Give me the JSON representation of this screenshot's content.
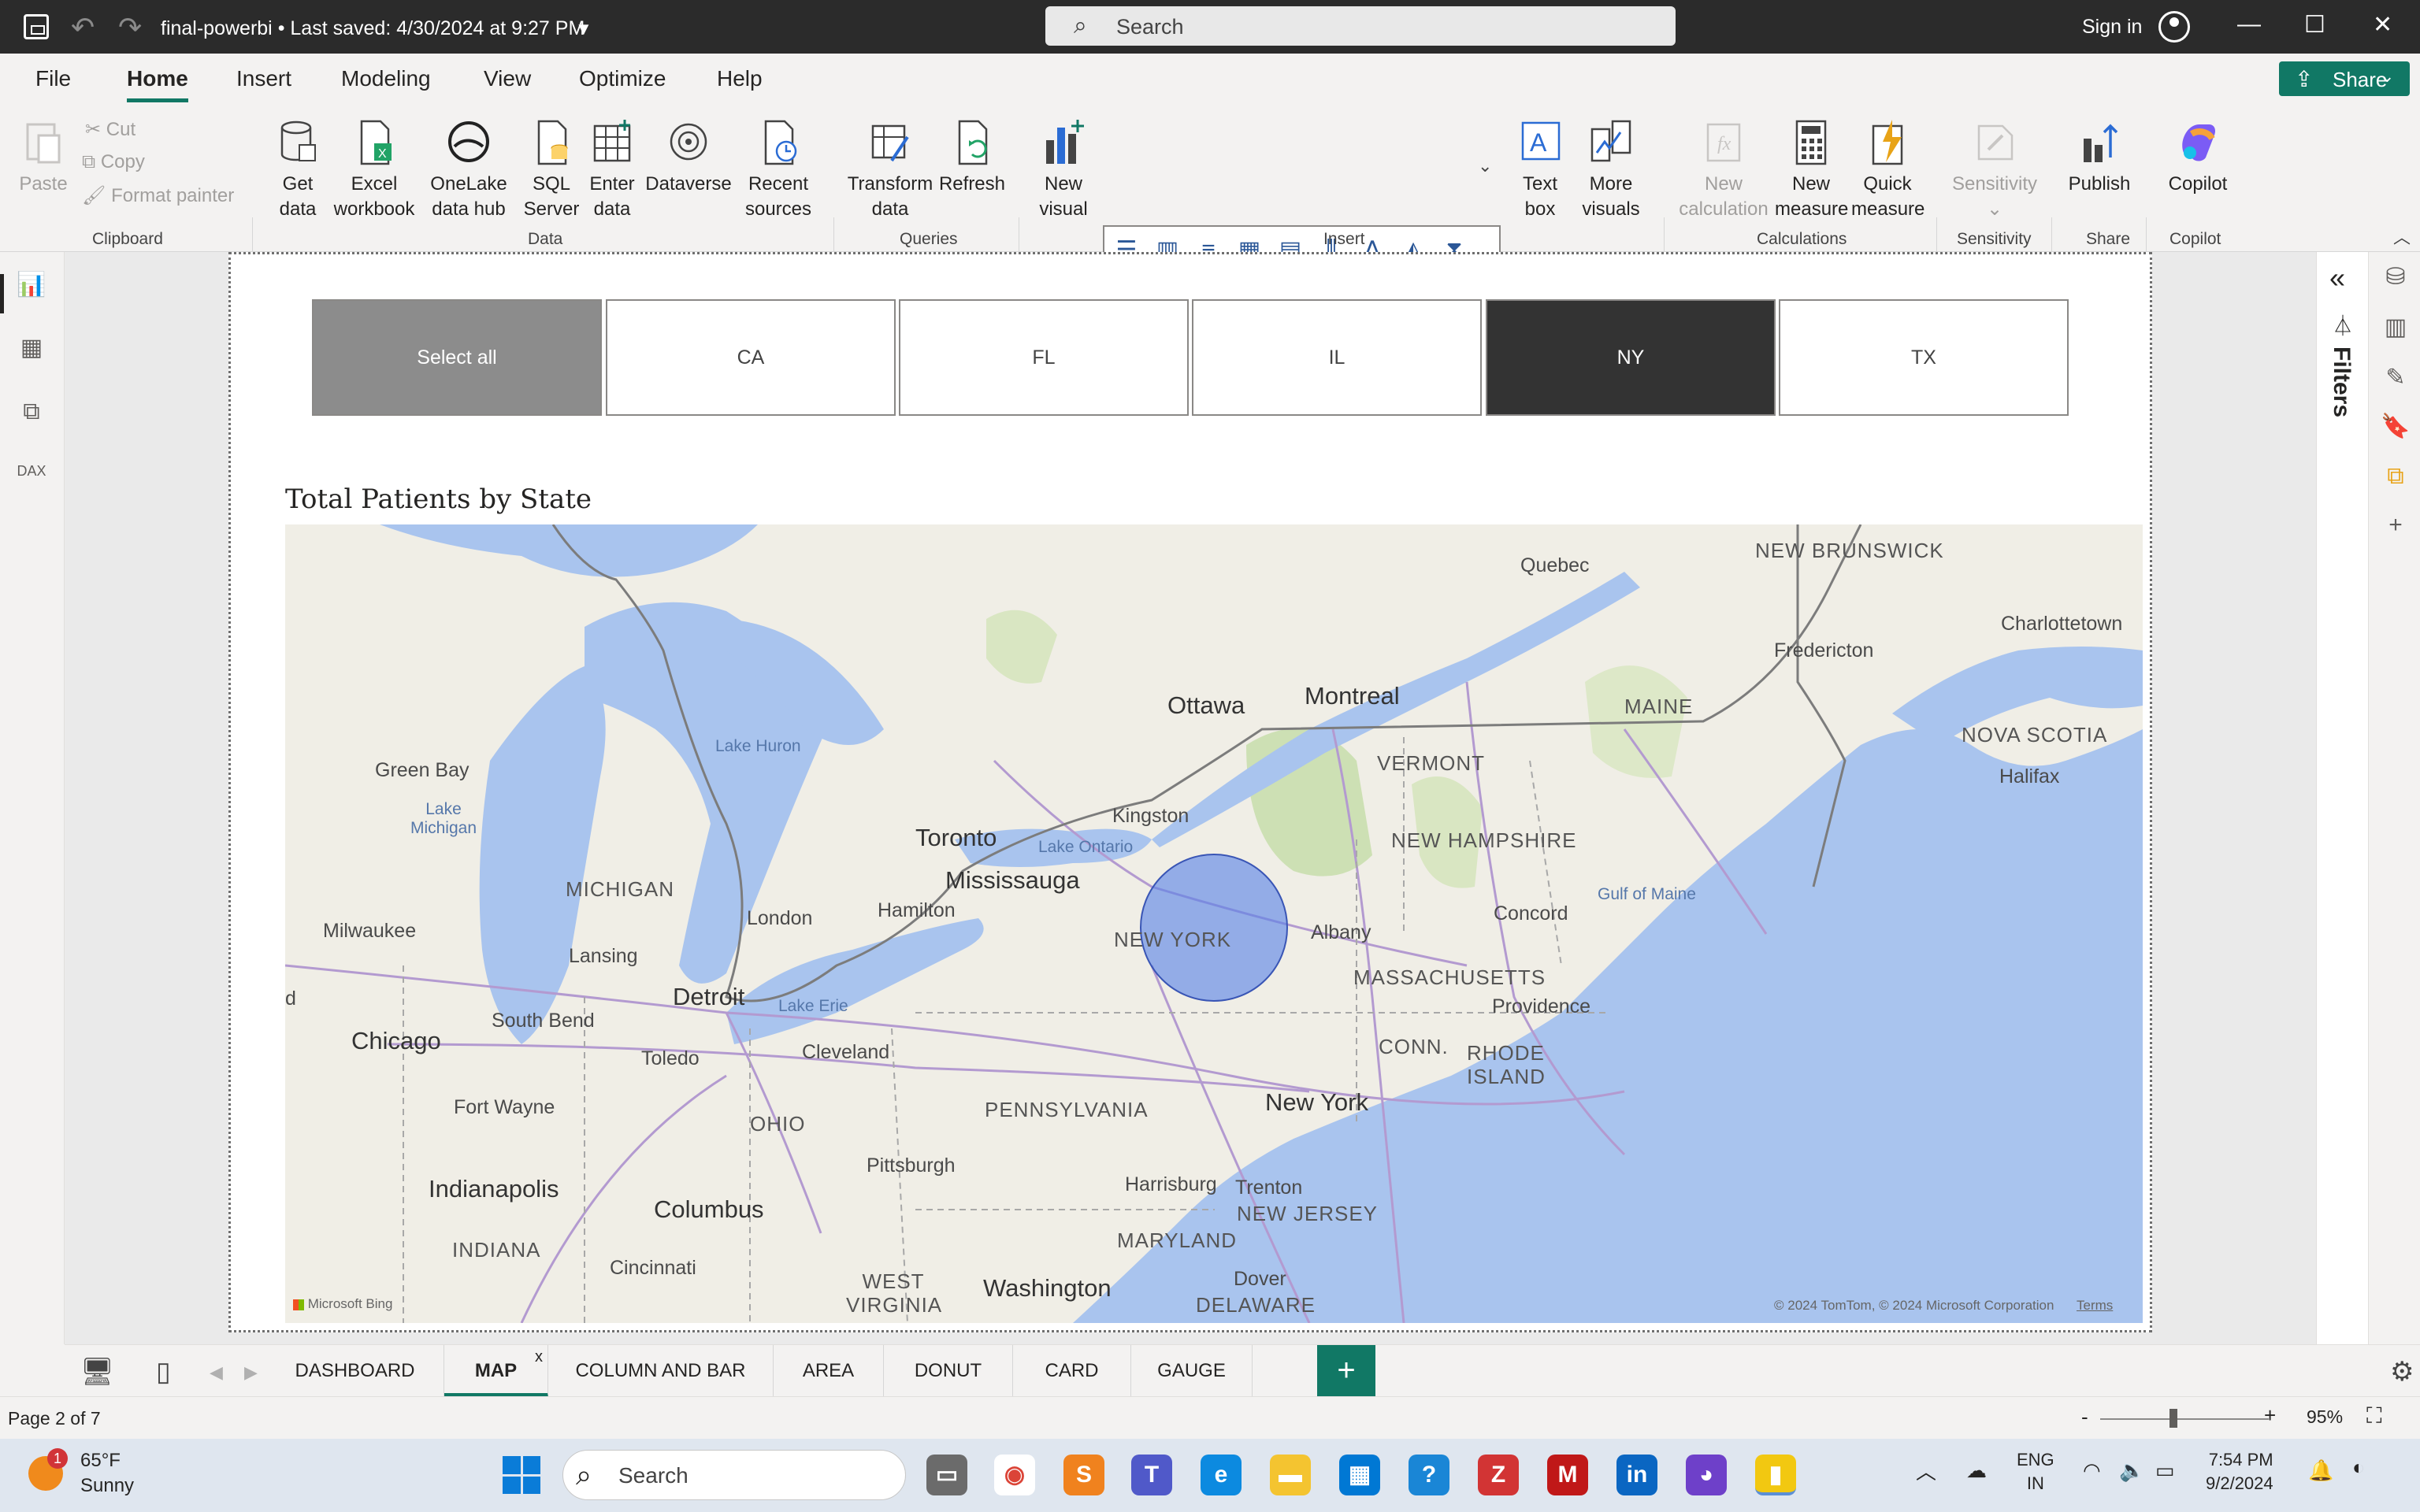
{
  "titlebar": {
    "filename": "final-powerbi",
    "saved": "Last saved: 4/30/2024 at 9:27 PM",
    "search_placeholder": "Search",
    "signin": "Sign in"
  },
  "menu": [
    "File",
    "Home",
    "Insert",
    "Modeling",
    "View",
    "Optimize",
    "Help"
  ],
  "share_label": "Share",
  "ribbon": {
    "clipboard": {
      "paste": "Paste",
      "cut": "Cut",
      "copy": "Copy",
      "format_painter": "Format painter",
      "group": "Clipboard"
    },
    "data": {
      "get_data": "Get data",
      "excel": "Excel workbook",
      "onelake": "OneLake data hub",
      "sql": "SQL Server",
      "enter": "Enter data",
      "dataverse": "Dataverse",
      "recent": "Recent sources",
      "group": "Data"
    },
    "queries": {
      "transform": "Transform data",
      "refresh": "Refresh",
      "group": "Queries"
    },
    "insert": {
      "new_visual": "New visual",
      "text_box": "Text box",
      "more_visuals": "More visuals",
      "group": "Insert"
    },
    "calculations": {
      "new_calc": "New calculation",
      "new_measure": "New measure",
      "quick_measure": "Quick measure",
      "group": "Calculations"
    },
    "sensitivity": {
      "label": "Sensitivity",
      "group": "Sensitivity"
    },
    "share": {
      "publish": "Publish",
      "group": "Share"
    },
    "copilot": {
      "label": "Copilot",
      "group": "Copilot"
    }
  },
  "slicer": [
    "Select all",
    "CA",
    "FL",
    "IL",
    "NY",
    "TX"
  ],
  "visual": {
    "title": "Total Patients by State"
  },
  "map": {
    "bubble_state": "NEW YORK",
    "labels": {
      "quebec": "Quebec",
      "new_brunswick": "NEW BRUNSWICK",
      "charlottetown": "Charlottetown",
      "fredericton": "Fredericton",
      "ottawa": "Ottawa",
      "montreal": "Montreal",
      "maine": "MAINE",
      "nova_scotia": "NOVA SCOTIA",
      "halifax": "Halifax",
      "green_bay": "Green Bay",
      "lake_huron": "Lake Huron",
      "vermont": "VERMONT",
      "lake_michigan": "Lake Michigan",
      "kingston": "Kingston",
      "toronto": "Toronto",
      "new_hampshire": "NEW HAMPSHIRE",
      "lake_ontario": "Lake Ontario",
      "mississauga": "Mississauga",
      "michigan": "MICHIGAN",
      "gulf_of_maine": "Gulf of Maine",
      "london": "London",
      "hamilton": "Hamilton",
      "concord": "Concord",
      "milwaukee": "Milwaukee",
      "albany": "Albany",
      "lansing": "Lansing",
      "massachusetts": "MASSACHUSETTS",
      "detroit": "Detroit",
      "providence": "Providence",
      "lake_erie": "Lake Erie",
      "south_bend": "South Bend",
      "conn": "CONN.",
      "rhode_island": "RHODE ISLAND",
      "chicago": "Chicago",
      "toledo": "Toledo",
      "cleveland": "Cleveland",
      "new_york_city": "New York",
      "fort_wayne": "Fort Wayne",
      "pennsylvania": "PENNSYLVANIA",
      "ohio": "OHIO",
      "pittsburgh": "Pittsburgh",
      "indianapolis": "Indianapolis",
      "harrisburg": "Harrisburg",
      "trenton": "Trenton",
      "columbus": "Columbus",
      "indiana": "INDIANA",
      "new_jersey": "NEW JERSEY",
      "maryland": "MARYLAND",
      "cincinnati": "Cincinnati",
      "west_virginia": "WEST VIRGINIA",
      "washington": "Washington",
      "dover": "Dover",
      "delaware": "DELAWARE",
      "edge_d": "d"
    },
    "attribution_left": "Microsoft Bing",
    "attribution_right": "© 2024 TomTom, © 2024 Microsoft Corporation",
    "terms": "Terms"
  },
  "filters_label": "Filters",
  "tabs": [
    "DASHBOARD",
    "MAP",
    "COLUMN AND BAR",
    "AREA",
    "DONUT",
    "CARD",
    "GAUGE"
  ],
  "status": {
    "page": "Page 2 of 7",
    "zoom": "95%",
    "zoom_level": 0.95
  },
  "taskbar": {
    "weather_badge": "1",
    "temp": "65°F",
    "condition": "Sunny",
    "search": "Search",
    "lang1": "ENG",
    "lang2": "IN",
    "time": "7:54 PM",
    "date": "9/2/2024"
  },
  "colors": {
    "accent": "#117865",
    "bubble": "#5a82e6",
    "selected_slicer": "#333333",
    "selectall_slicer": "#8c8c8c"
  }
}
